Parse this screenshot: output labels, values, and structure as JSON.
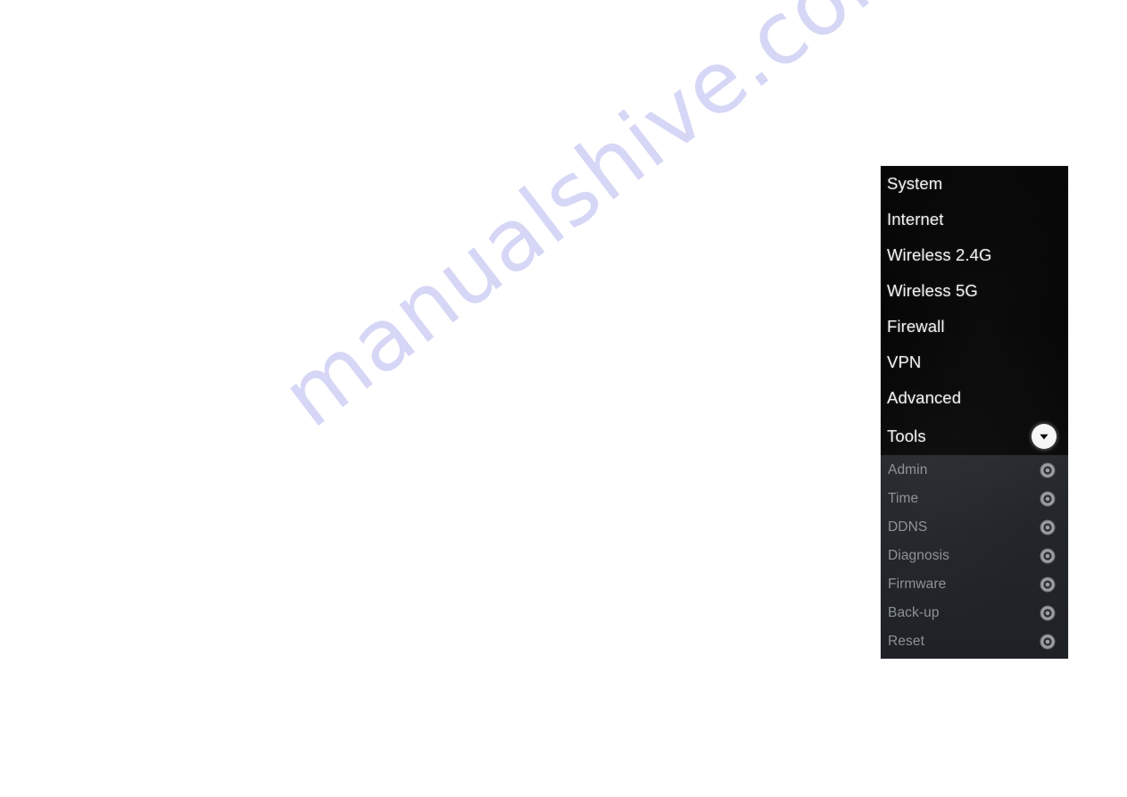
{
  "page": {
    "background_color": "#ffffff",
    "watermark_text": "manualshive.com",
    "watermark_color": "#d6d6f6"
  },
  "nav_panel": {
    "background_color": "#050505",
    "submenu_background_color": "#22252a",
    "label_color": "#f2f2f2",
    "submenu_label_color": "#8d9298",
    "main_items": [
      {
        "label": "System",
        "icon": ""
      },
      {
        "label": "Internet",
        "icon": ""
      },
      {
        "label": "Wireless 2.4G",
        "icon": ""
      },
      {
        "label": "Wireless 5G",
        "icon": ""
      },
      {
        "label": "Firewall",
        "icon": ""
      },
      {
        "label": "VPN",
        "icon": ""
      },
      {
        "label": "Advanced",
        "icon": ""
      },
      {
        "label": "Tools",
        "icon": "chevron-down-circle-icon",
        "expanded": true
      }
    ],
    "sub_items": [
      {
        "label": "Admin",
        "icon": "gear-icon"
      },
      {
        "label": "Time",
        "icon": "gear-icon"
      },
      {
        "label": "DDNS",
        "icon": "gear-icon"
      },
      {
        "label": "Diagnosis",
        "icon": "gear-icon"
      },
      {
        "label": "Firmware",
        "icon": "gear-icon"
      },
      {
        "label": "Back-up",
        "icon": "gear-icon"
      },
      {
        "label": "Reset",
        "icon": "gear-icon"
      }
    ]
  }
}
